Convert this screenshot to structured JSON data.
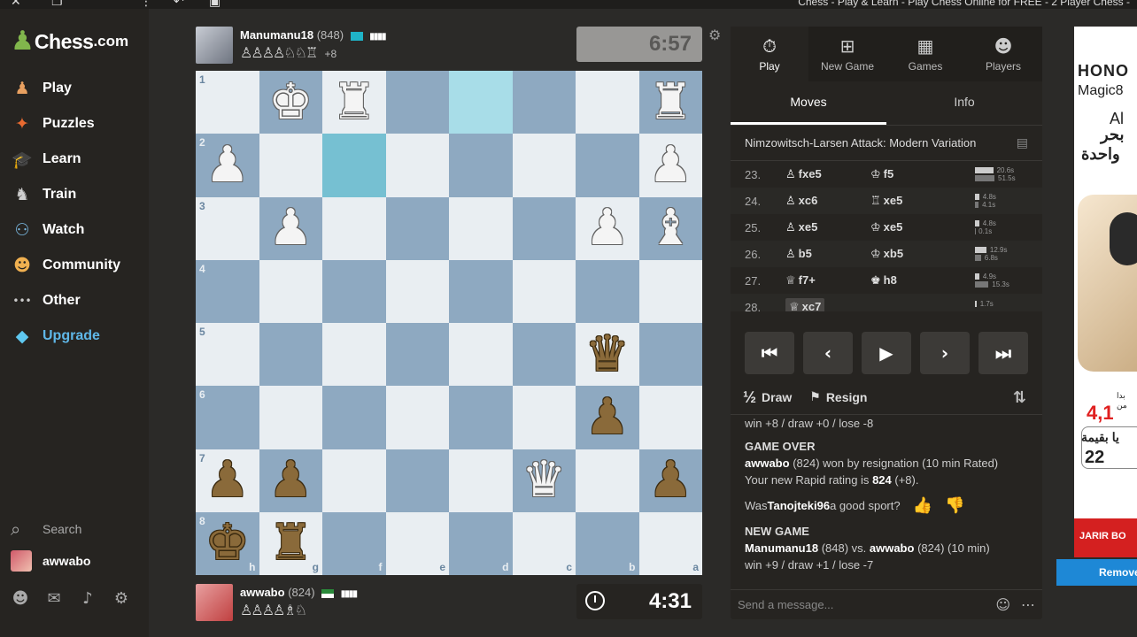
{
  "window": {
    "title": "Chess - Play & Learn - Play Chess Online for FREE - 2 Player Chess -"
  },
  "logo": {
    "word": "Chess",
    "suffix": ".com"
  },
  "sidebar": {
    "items": [
      {
        "label": "Play",
        "icon": "play-pawn-icon",
        "glyph": "♟",
        "color": "#e8a060"
      },
      {
        "label": "Puzzles",
        "icon": "puzzle-icon",
        "glyph": "✦",
        "color": "#e86a30"
      },
      {
        "label": "Learn",
        "icon": "learn-cap-icon",
        "glyph": "🎓",
        "color": "#4aa6d8"
      },
      {
        "label": "Train",
        "icon": "train-icon",
        "glyph": "♞",
        "color": "#d0d0d0"
      },
      {
        "label": "Watch",
        "icon": "watch-binoculars-icon",
        "glyph": "⚇",
        "color": "#7ab8e0"
      },
      {
        "label": "Community",
        "icon": "community-icon",
        "glyph": "☻",
        "color": "#f0b050"
      },
      {
        "label": "Other",
        "icon": "more-dots-icon",
        "glyph": "•••",
        "color": "#cccccc"
      },
      {
        "label": "Upgrade",
        "icon": "diamond-icon",
        "glyph": "◆",
        "color": "#5fc8f0"
      }
    ],
    "search_label": "Search",
    "username": "awwabo"
  },
  "top_player": {
    "name": "Manumanu18",
    "rating": "(848)",
    "captured": "♙♙♙♙♘♘♖",
    "advantage": "+8",
    "clock": "6:57"
  },
  "bottom_player": {
    "name": "awwabo",
    "rating": "(824)",
    "captured": "♙♙♙♙♗♘",
    "clock": "4:31"
  },
  "board": {
    "orientation": "black-bottom",
    "files": [
      "h",
      "g",
      "f",
      "e",
      "d",
      "c",
      "b",
      "a"
    ],
    "ranks": [
      "1",
      "2",
      "3",
      "4",
      "5",
      "6",
      "7",
      "8"
    ],
    "highlights": [
      "f2",
      "d1"
    ],
    "pieces": {
      "g1": "wK",
      "f1": "wR",
      "a1": "wR",
      "h2": "wP",
      "a2": "wP",
      "g3": "wP",
      "b3": "wP",
      "a3": "wB",
      "b5": "bQ",
      "b6": "bP",
      "h7": "bP",
      "g7": "bP",
      "c7": "wQ",
      "a7": "bP",
      "h8": "bK",
      "g8": "bR"
    }
  },
  "panel": {
    "tabs": [
      {
        "label": "Play",
        "glyph": "⏱"
      },
      {
        "label": "New Game",
        "glyph": "⊞"
      },
      {
        "label": "Games",
        "glyph": "▦"
      },
      {
        "label": "Players",
        "glyph": "☻"
      }
    ],
    "subtabs": [
      "Moves",
      "Info"
    ],
    "opening": "Nimzowitsch-Larsen Attack: Modern Variation",
    "moves": [
      {
        "num": "23.",
        "w_piece": "♙",
        "w": "fxe5",
        "b_piece": "♔",
        "b": "f5",
        "t1": "20.6s",
        "t2": "51.5s"
      },
      {
        "num": "24.",
        "w_piece": "♙",
        "w": "xc6",
        "b_piece": "♖",
        "b": "xe5",
        "t1": "4.8s",
        "t2": "4.1s"
      },
      {
        "num": "25.",
        "w_piece": "♙",
        "w": "xe5",
        "b_piece": "♔",
        "b": "xe5",
        "t1": "4.8s",
        "t2": "0.1s"
      },
      {
        "num": "26.",
        "w_piece": "♙",
        "w": "b5",
        "b_piece": "♔",
        "b": "xb5",
        "t1": "12.9s",
        "t2": "6.8s"
      },
      {
        "num": "27.",
        "w_piece": "♕",
        "w": "f7+",
        "b_piece": "♚",
        "b": "h8",
        "t1": "4.9s",
        "t2": "15.3s"
      },
      {
        "num": "28.",
        "w_piece": "♕",
        "w": "xc7",
        "b_piece": "",
        "b": "",
        "t1": "1.7s",
        "t2": ""
      }
    ],
    "actions": {
      "draw": "Draw",
      "resign": "Resign",
      "half": "½"
    },
    "chat": {
      "line0": "win +8 / draw +0 / lose -8",
      "game_over": "GAME OVER",
      "result_name": "awwabo",
      "result_text": " (824) won by resignation (10 min Rated)",
      "rating_prefix": "Your new Rapid rating is ",
      "rating_value": "824",
      "rating_suffix": " (+8).",
      "sport_prefix": "Was ",
      "sport_name": "Tanojteki96",
      "sport_suffix": " a good sport?",
      "new_game": "NEW GAME",
      "ng_p1": "Manumanu18",
      "ng_mid": " (848) vs. ",
      "ng_p2": "awwabo",
      "ng_end": " (824) (10 min)",
      "ng_record": "win +9 / draw +1 / lose -7"
    },
    "message_placeholder": "Send a message..."
  },
  "ad": {
    "brand": "HONO",
    "model": "Magic8",
    "ar1": "Al",
    "ar2": "بحر",
    "ar3": "واحدة",
    "small": "بدا من",
    "price1": "4,1",
    "offer": "يا بقيمة",
    "price2": "22",
    "strip": "JARIR BO",
    "remove": "Remove"
  }
}
